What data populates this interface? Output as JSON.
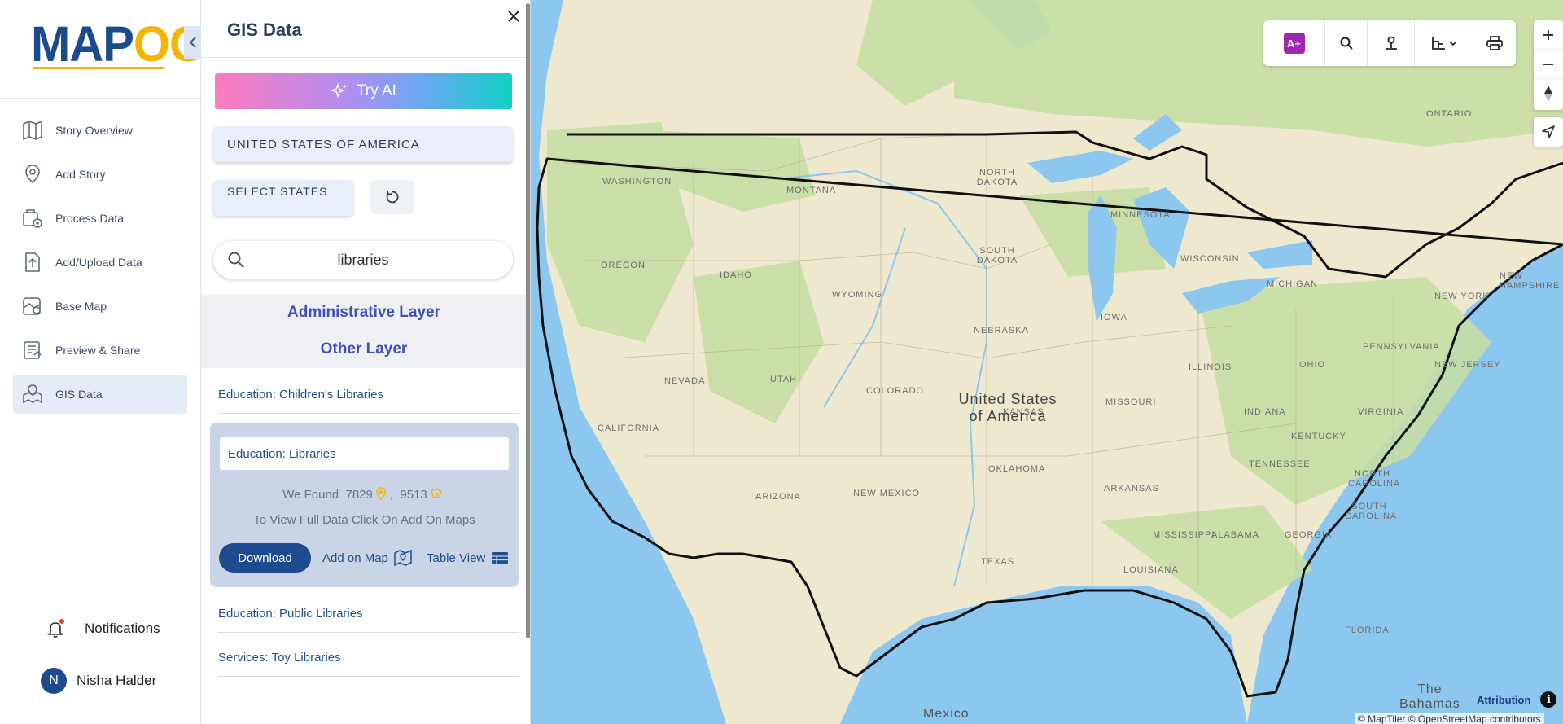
{
  "app": {
    "logo_text_main": "MAP",
    "logo_text_accent": "OG"
  },
  "nav": {
    "items": [
      {
        "label": "Story Overview",
        "icon": "map-book-icon"
      },
      {
        "label": "Add Story",
        "icon": "location-pin-icon"
      },
      {
        "label": "Process Data",
        "icon": "data-process-icon"
      },
      {
        "label": "Add/Upload Data",
        "icon": "upload-file-icon"
      },
      {
        "label": "Base Map",
        "icon": "base-map-icon"
      },
      {
        "label": "Preview & Share",
        "icon": "preview-share-icon"
      },
      {
        "label": "GIS Data",
        "icon": "gis-data-icon",
        "active": true
      }
    ],
    "notifications_label": "Notifications",
    "user": {
      "initial": "N",
      "name": "Nisha Halder"
    }
  },
  "panel": {
    "title": "GIS Data",
    "try_ai_label": "Try AI",
    "country_label": "UNITED STATES OF AMERICA",
    "select_states_label": "SELECT STATES",
    "search": {
      "value": "libraries",
      "placeholder": ""
    },
    "layer_headers": [
      "Administrative Layer",
      "Other Layer"
    ],
    "results": {
      "item1": "Education: Children's Libraries",
      "expanded": {
        "title": "Education: Libraries",
        "found_prefix": "We Found",
        "count_points": "7829",
        "count_polygons": "9513",
        "separator": ",",
        "hint": "To View Full Data Click On Add On Maps",
        "download_label": "Download",
        "add_on_map_label": "Add on Map",
        "table_view_label": "Table View"
      },
      "item3": "Education: Public Libraries",
      "item4": "Services: Toy Libraries"
    }
  },
  "map": {
    "country_label_line1": "United States",
    "country_label_line2": "of America",
    "state_labels": [
      "WASHINGTON",
      "OREGON",
      "CALIFORNIA",
      "NEVADA",
      "IDAHO",
      "MONTANA",
      "WYOMING",
      "UTAH",
      "ARIZONA",
      "COLORADO",
      "NEW MEXICO",
      "NORTH DAKOTA",
      "SOUTH DAKOTA",
      "NEBRASKA",
      "KANSAS",
      "OKLAHOMA",
      "TEXAS",
      "MINNESOTA",
      "IOWA",
      "MISSOURI",
      "ARKANSAS",
      "LOUISIANA",
      "WISCONSIN",
      "ILLINOIS",
      "MISSISSIPPI",
      "ALABAMA",
      "TENNESSEE",
      "MICHIGAN",
      "INDIANA",
      "OHIO",
      "KENTUCKY",
      "GEORGIA",
      "FLORIDA",
      "SOUTH CAROLINA",
      "NORTH CAROLINA",
      "VIRGINIA",
      "PENNSYLVANIA",
      "NEW YORK",
      "NEW JERSEY",
      "NEW HAMPSHIRE",
      "ONTARIO"
    ],
    "other_labels": {
      "mexico": "Mexico",
      "bahamas_1": "The",
      "bahamas_2": "Bahamas",
      "ontario": "ONTARIO",
      "kentucky": "KENTUCKY",
      "nw": "NEW"
    },
    "attribution_label": "Attribution",
    "attribution_text": "© MapTiler © OpenStreetMap contributors",
    "toolbar": [
      "ai-assistant-icon",
      "search-icon",
      "person-pin-icon",
      "layers-dropdown-icon",
      "print-icon"
    ],
    "colors": {
      "land": "#eee8cf",
      "water": "#8cc7f0",
      "forest": "#c7dea4",
      "border": "#111111"
    }
  }
}
